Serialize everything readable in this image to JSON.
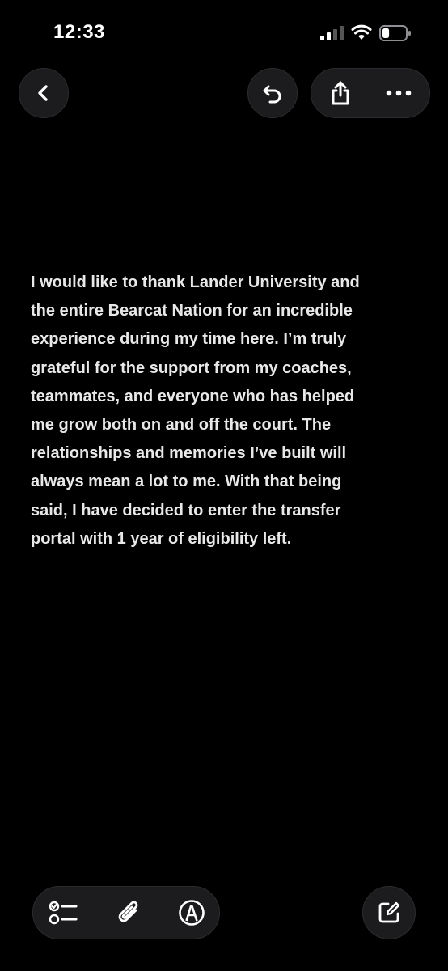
{
  "status_bar": {
    "time": "12:33"
  },
  "icons": {
    "back": "chevron-left-icon",
    "undo": "undo-arrow-icon",
    "share": "share-icon",
    "more": "ellipsis-icon",
    "checklist": "checklist-icon",
    "attachment": "paperclip-icon",
    "markup": "markup-pen-icon",
    "compose": "compose-icon"
  },
  "note": {
    "body": "I would like to thank Lander University and\nthe entire Bearcat Nation for an incredible\nexperience during my time here. I’m truly\ngrateful for the support from my coaches,\nteammates, and everyone who has helped\nme grow both on and off the court. The\nrelationships and memories I’ve built will\nalways mean a lot to me. With that being\nsaid, I have decided to enter the transfer\nportal with 1 year of eligibility left."
  },
  "colors": {
    "background": "#000000",
    "text": "#e8e8e8",
    "button_fill": "#1c1c1e",
    "battery_level": 0.3
  }
}
